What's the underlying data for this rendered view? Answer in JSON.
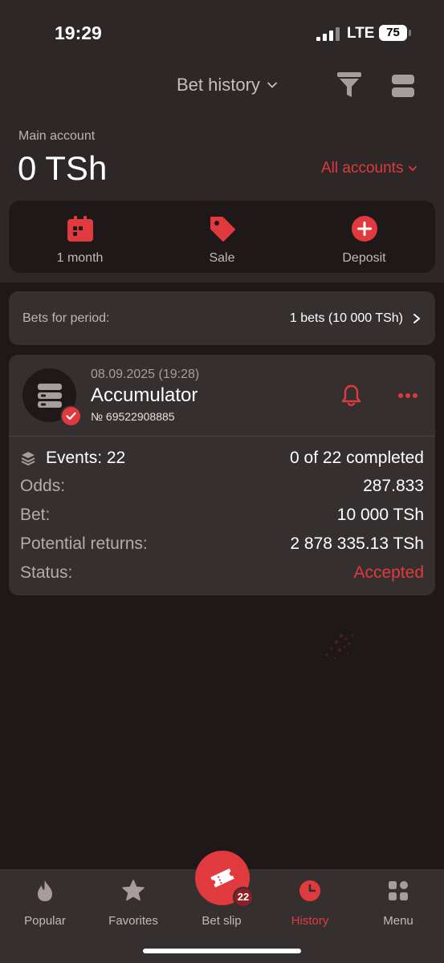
{
  "status_bar": {
    "time": "19:29",
    "network": "LTE",
    "battery": "75"
  },
  "header": {
    "title": "Bet history"
  },
  "account": {
    "label": "Main account",
    "balance": "0 TSh",
    "switch_label": "All accounts"
  },
  "actions": [
    {
      "label": "1 month",
      "icon": "calendar-icon"
    },
    {
      "label": "Sale",
      "icon": "tag-icon"
    },
    {
      "label": "Deposit",
      "icon": "plus-circle-icon"
    }
  ],
  "period": {
    "label": "Bets for period:",
    "value": "1 bets (10 000 TSh)"
  },
  "bet": {
    "datetime": "08.09.2025 (19:28)",
    "type": "Accumulator",
    "number": "№ 69522908885",
    "events_label": "Events: 22",
    "progress": "0 of 22 completed",
    "odds_label": "Odds:",
    "odds": "287.833",
    "stake_label": "Bet:",
    "stake": "10 000 TSh",
    "returns_label": "Potential returns:",
    "returns": "2 878 335.13 TSh",
    "status_label": "Status:",
    "status": "Accepted"
  },
  "nav": {
    "popular": "Popular",
    "favorites": "Favorites",
    "bet_slip": "Bet slip",
    "bet_slip_count": "22",
    "history": "History",
    "menu": "Menu"
  },
  "colors": {
    "accent": "#e03a3e",
    "background": "#1f1818",
    "surface": "#362f2f"
  }
}
